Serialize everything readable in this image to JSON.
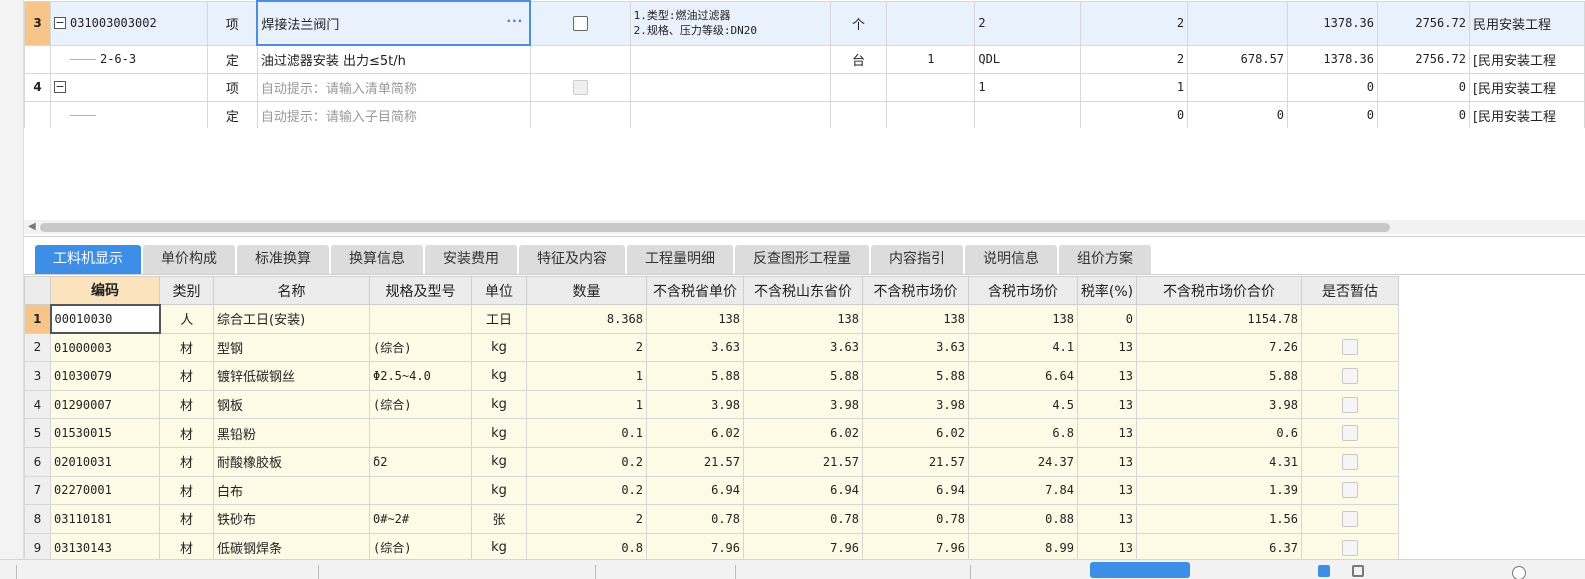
{
  "top_grid": {
    "rows": [
      {
        "index": "3",
        "code": "031003003002",
        "type": "项",
        "name": "焊接法兰阀门",
        "name_ellipsis": "···",
        "features_line1": "1.类型:燃油过滤器",
        "features_line2": "2.规格、压力等级:DN20",
        "unit": "个",
        "qty_factor": "",
        "expr": "2",
        "qty": "2",
        "unit_price": "",
        "comp_price": "1378.36",
        "total": "2756.72",
        "major": "民用安装工程"
      },
      {
        "index": "",
        "code": "2-6-3",
        "type": "定",
        "name": "油过滤器安装 出力≤5t/h",
        "features": "",
        "unit": "台",
        "qty_factor": "1",
        "expr": "QDL",
        "qty": "2",
        "unit_price": "678.57",
        "comp_price": "1378.36",
        "total": "2756.72",
        "major": "[民用安装工程"
      },
      {
        "index": "4",
        "code": "",
        "type": "项",
        "name": "自动提示：请输入清单简称",
        "features": "",
        "unit": "",
        "qty_factor": "",
        "expr": "1",
        "qty": "1",
        "unit_price": "",
        "comp_price": "0",
        "total": "0",
        "major": "[民用安装工程"
      },
      {
        "index": "",
        "code": "",
        "type": "定",
        "name": "自动提示：请输入子目简称",
        "features": "",
        "unit": "",
        "qty_factor": "",
        "expr": "",
        "qty": "0",
        "unit_price": "0",
        "comp_price": "0",
        "total": "0",
        "major": "[民用安装工程"
      }
    ]
  },
  "tabs": [
    "工料机显示",
    "单价构成",
    "标准换算",
    "换算信息",
    "安装费用",
    "特征及内容",
    "工程量明细",
    "反查图形工程量",
    "内容指引",
    "说明信息",
    "组价方案"
  ],
  "active_tab": "工料机显示",
  "bottom_grid": {
    "headers": [
      "编码",
      "类别",
      "名称",
      "规格及型号",
      "单位",
      "数量",
      "不含税省单价",
      "不含税山东省价",
      "不含税市场价",
      "含税市场价",
      "税率(%)",
      "不含税市场价合价",
      "是否暂估"
    ],
    "rows": [
      {
        "n": "1",
        "code": "00010030",
        "cat": "人",
        "name": "综合工日(安装)",
        "spec": "",
        "unit": "工日",
        "qty": "8.368",
        "prov": "138",
        "sd": "138",
        "mkt": "138",
        "tax_mkt": "138",
        "rate": "0",
        "total": "1154.78"
      },
      {
        "n": "2",
        "code": "01000003",
        "cat": "材",
        "name": "型钢",
        "spec": "(综合)",
        "unit": "kg",
        "qty": "2",
        "prov": "3.63",
        "sd": "3.63",
        "mkt": "3.63",
        "tax_mkt": "4.1",
        "rate": "13",
        "total": "7.26"
      },
      {
        "n": "3",
        "code": "01030079",
        "cat": "材",
        "name": "镀锌低碳钢丝",
        "spec": "Φ2.5~4.0",
        "unit": "kg",
        "qty": "1",
        "prov": "5.88",
        "sd": "5.88",
        "mkt": "5.88",
        "tax_mkt": "6.64",
        "rate": "13",
        "total": "5.88"
      },
      {
        "n": "4",
        "code": "01290007",
        "cat": "材",
        "name": "钢板",
        "spec": "(综合)",
        "unit": "kg",
        "qty": "1",
        "prov": "3.98",
        "sd": "3.98",
        "mkt": "3.98",
        "tax_mkt": "4.5",
        "rate": "13",
        "total": "3.98"
      },
      {
        "n": "5",
        "code": "01530015",
        "cat": "材",
        "name": "黑铅粉",
        "spec": "",
        "unit": "kg",
        "qty": "0.1",
        "prov": "6.02",
        "sd": "6.02",
        "mkt": "6.02",
        "tax_mkt": "6.8",
        "rate": "13",
        "total": "0.6"
      },
      {
        "n": "6",
        "code": "02010031",
        "cat": "材",
        "name": "耐酸橡胶板",
        "spec": "δ2",
        "unit": "kg",
        "qty": "0.2",
        "prov": "21.57",
        "sd": "21.57",
        "mkt": "21.57",
        "tax_mkt": "24.37",
        "rate": "13",
        "total": "4.31"
      },
      {
        "n": "7",
        "code": "02270001",
        "cat": "材",
        "name": "白布",
        "spec": "",
        "unit": "kg",
        "qty": "0.2",
        "prov": "6.94",
        "sd": "6.94",
        "mkt": "6.94",
        "tax_mkt": "7.84",
        "rate": "13",
        "total": "1.39"
      },
      {
        "n": "8",
        "code": "03110181",
        "cat": "材",
        "name": "铁砂布",
        "spec": "0#~2#",
        "unit": "张",
        "qty": "2",
        "prov": "0.78",
        "sd": "0.78",
        "mkt": "0.78",
        "tax_mkt": "0.88",
        "rate": "13",
        "total": "1.56"
      },
      {
        "n": "9",
        "code": "03130143",
        "cat": "材",
        "name": "低碳钢焊条",
        "spec": "(综合)",
        "unit": "kg",
        "qty": "0.8",
        "prov": "7.96",
        "sd": "7.96",
        "mkt": "7.96",
        "tax_mkt": "8.99",
        "rate": "13",
        "total": "6.37"
      }
    ]
  },
  "colors": {
    "accent": "#3c8ee6",
    "selected_row": "#e9f1fc",
    "row_marker": "#f7c58a",
    "material_bg": "#fdfbe6"
  }
}
